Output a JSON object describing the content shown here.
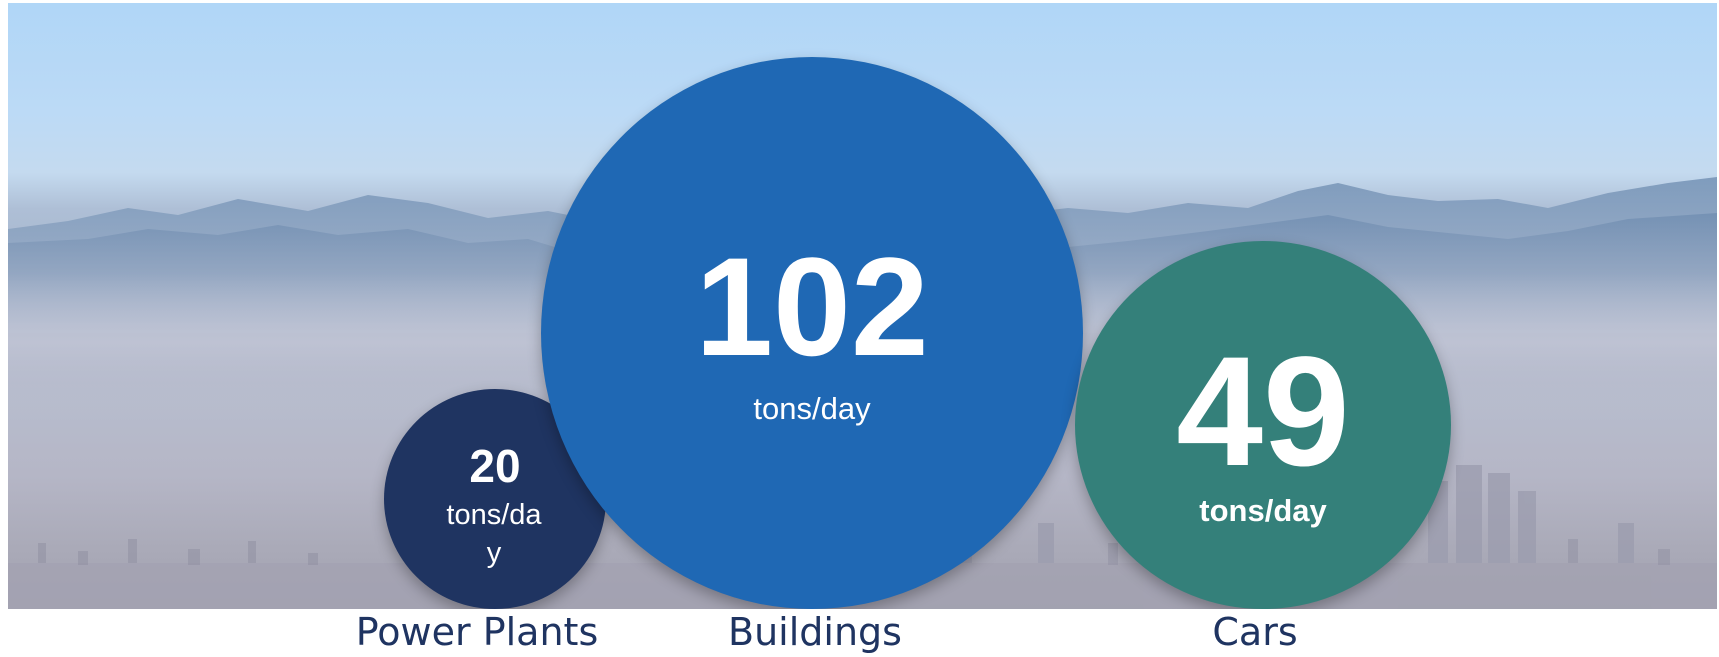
{
  "sources": [
    {
      "id": "buildings",
      "value": "102",
      "unit": "tons/day",
      "label": "Buildings",
      "color": "#1f68b4"
    },
    {
      "id": "cars",
      "value": "49",
      "unit": "tons/day",
      "label": "Cars",
      "color": "#34807a"
    },
    {
      "id": "power",
      "value": "20",
      "unit": "tons/day",
      "label": "Power Plants",
      "color": "#1f3461"
    }
  ],
  "colors": {
    "label_text": "#1f3461",
    "sky": "#b0d6f7",
    "haze": "#b5b6c6"
  }
}
